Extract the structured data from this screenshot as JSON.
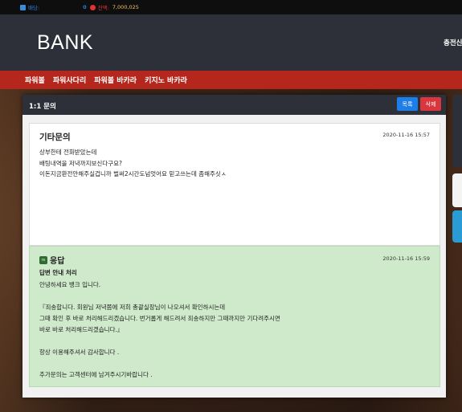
{
  "topbar": {
    "bet_label": "배당:",
    "bet_value": "0",
    "cash_label": "잔액:",
    "cash_value": "7,000,025"
  },
  "header": {
    "logo": "BANK",
    "right_link": "충전신"
  },
  "nav": {
    "items": [
      "파워볼",
      "파워사다리",
      "파워볼 바카라",
      "키지노 바카라"
    ]
  },
  "modal": {
    "title": "1:1 문의",
    "list_button": "목록",
    "delete_button": "삭제"
  },
  "question": {
    "title": "기타문의",
    "date": "2020-11-16 15:57",
    "body": "상부한테 전화받았는데\n배팅내역을 저녁까지보신다구요?\n이돈지금환전안해주실겁니까 벌써2시간도넘엇어요 믿고쓰는데 좀해주싯ㅅ"
  },
  "answer": {
    "icon": "re",
    "title": "응답",
    "date": "2020-11-16 15:59",
    "subtitle": "답변 안내 처리",
    "body": "안녕하세요 뱅크 입니다.\n\n『죄송합니다. 회원님 저녁쯤에 저희 총괄실장님이 나오셔서 확인하시는데\n그때 확인 후 바로 처리해드리겠습니다. 번거롭게 해드려서 죄송하지만 그때까지만 기다려주시면\n바로 바로 처리해드리겠습니다.』\n\n항상 이용해주셔서 감사합니다 .\n\n추가문의는 고객센터에 남겨주시기바랍니다 ."
  },
  "colors": {
    "nav_red": "#b5271c",
    "header_dark": "#2d3038",
    "answer_green": "#cfeacb",
    "list_blue": "#1e7ee8",
    "delete_red": "#d9363e"
  }
}
